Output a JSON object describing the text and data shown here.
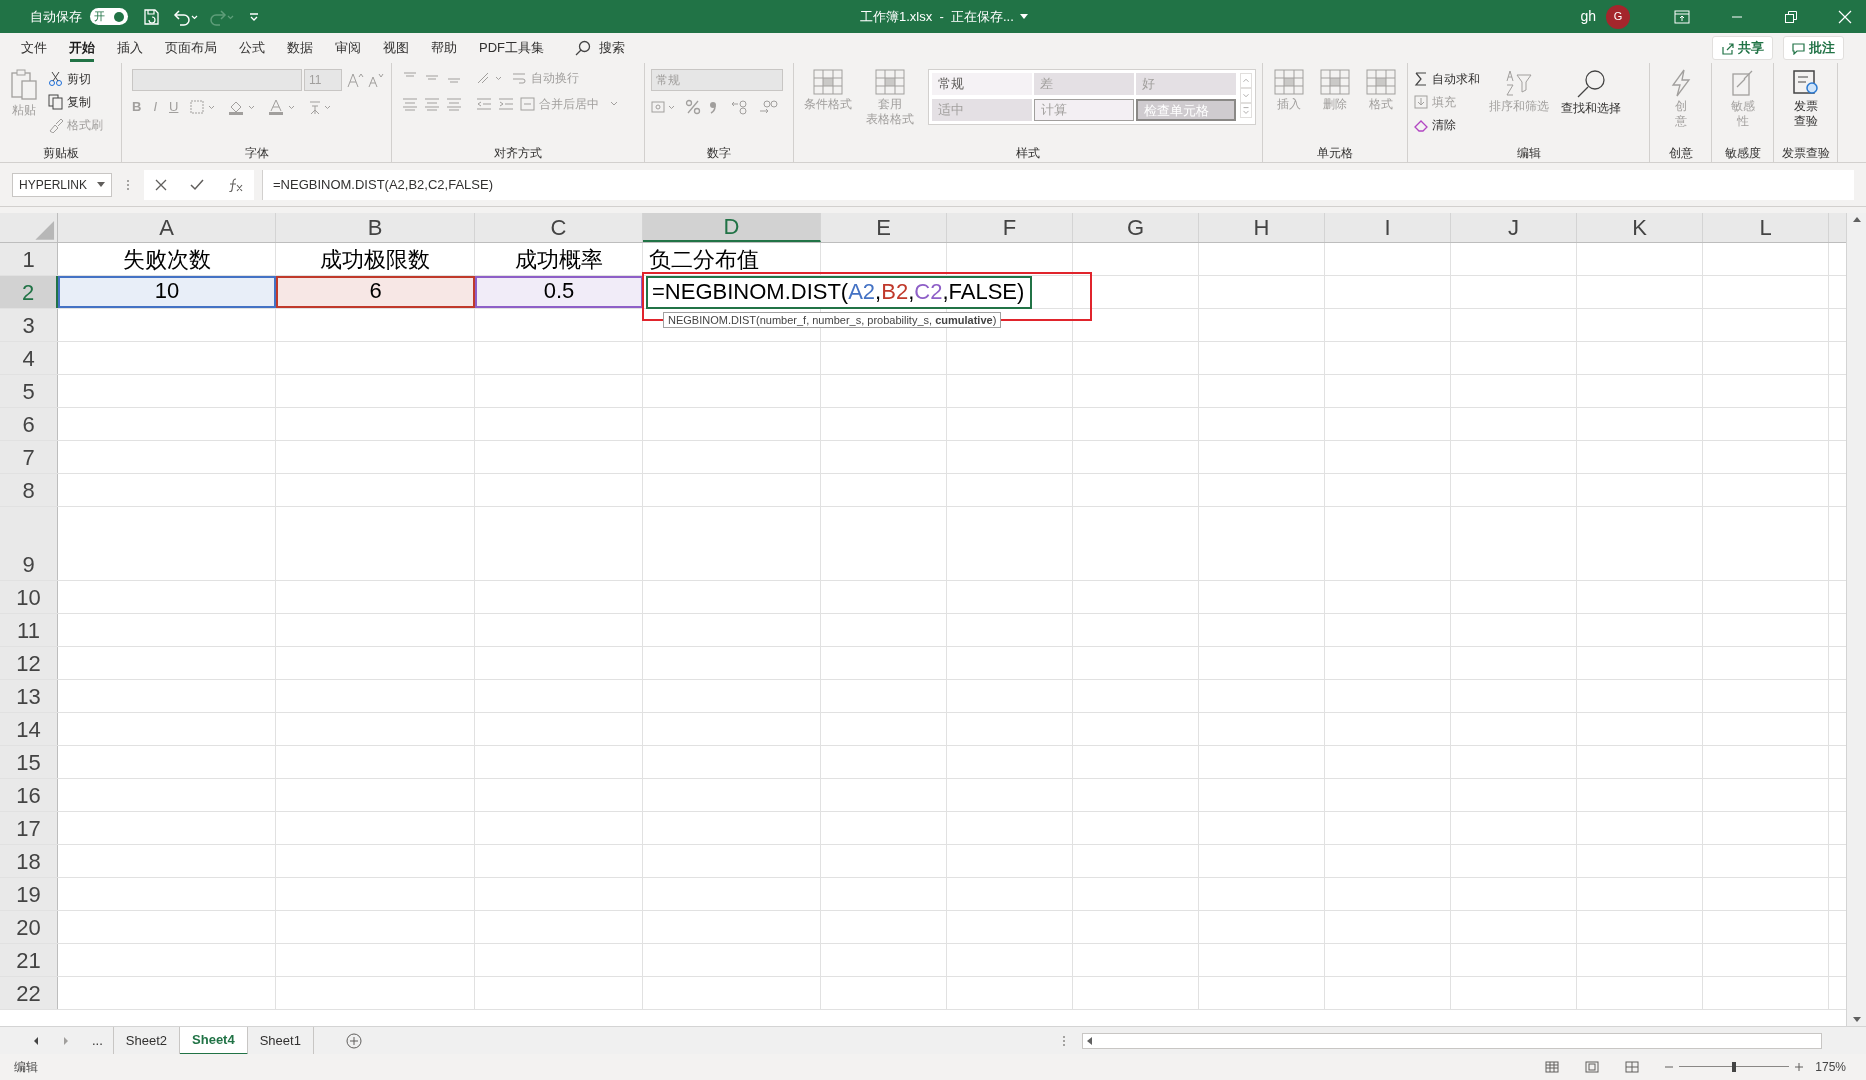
{
  "title_bar": {
    "autosave_label": "自动保存",
    "autosave_toggle": {
      "label": "开",
      "on": true
    },
    "title": "工作簿1.xlsx  -  正在保存...",
    "user": "gh",
    "avatar": "G"
  },
  "menu_tabs": [
    {
      "label": "文件",
      "selected": false
    },
    {
      "label": "开始",
      "selected": true
    },
    {
      "label": "插入",
      "selected": false
    },
    {
      "label": "页面布局",
      "selected": false
    },
    {
      "label": "公式",
      "selected": false
    },
    {
      "label": "数据",
      "selected": false
    },
    {
      "label": "审阅",
      "selected": false
    },
    {
      "label": "视图",
      "selected": false
    },
    {
      "label": "帮助",
      "selected": false
    },
    {
      "label": "PDF工具集",
      "selected": false
    }
  ],
  "search": {
    "label": "搜索"
  },
  "share_button": "共享",
  "comments_button": "批注",
  "ribbon": {
    "groups": [
      {
        "kind": "clipboard",
        "label": "剪贴板",
        "paste": {
          "label": "粘贴",
          "disabled": true
        },
        "tools": [
          {
            "label": "剪切",
            "disabled": false
          },
          {
            "label": "复制",
            "disabled": false
          },
          {
            "label": "格式刷",
            "disabled": true
          }
        ]
      },
      {
        "kind": "font",
        "label": "字体",
        "size": "11",
        "styles": [
          "B",
          "I",
          "U"
        ],
        "disabled": true
      },
      {
        "kind": "align",
        "label": "对齐方式",
        "tools": [
          {
            "label": "自动换行"
          },
          {
            "label": "合并后居中"
          }
        ],
        "disabled": true
      },
      {
        "kind": "number",
        "label": "数字",
        "format": "常规",
        "disabled": true
      },
      {
        "kind": "styles",
        "label": "样式",
        "buttons": [
          {
            "lines": [
              "条件格式"
            ],
            "disabled": true
          },
          {
            "lines": [
              "套用",
              "表格格式"
            ],
            "disabled": true
          }
        ],
        "cells": [
          {
            "label": "常规",
            "kind": "normal"
          },
          {
            "label": "差",
            "kind": "bad"
          },
          {
            "label": "好",
            "kind": "good"
          },
          {
            "label": "适中",
            "kind": "neutral"
          },
          {
            "label": "计算",
            "kind": "calc"
          },
          {
            "label": "检查单元格",
            "kind": "check"
          }
        ],
        "disabled": true
      },
      {
        "kind": "big",
        "label": "单元格",
        "buttons": [
          {
            "lines": [
              "插入"
            ],
            "disabled": true
          },
          {
            "lines": [
              "删除"
            ],
            "disabled": true
          },
          {
            "lines": [
              "格式"
            ],
            "disabled": true
          }
        ]
      },
      {
        "kind": "editing",
        "label": "编辑",
        "tools": [
          {
            "label": "自动求和",
            "disabled": false
          },
          {
            "label": "填充",
            "disabled": true
          },
          {
            "label": "清除",
            "disabled": false
          }
        ],
        "buttons": [
          {
            "lines": [
              "排序和筛选"
            ],
            "disabled": true
          },
          {
            "lines": [
              "查找和选择"
            ],
            "disabled": false
          }
        ]
      },
      {
        "kind": "big",
        "label": "创意",
        "buttons": [
          {
            "lines": [
              "创",
              "意"
            ],
            "disabled": true
          }
        ]
      },
      {
        "kind": "big",
        "label": "敏感度",
        "buttons": [
          {
            "lines": [
              "敏感",
              "性"
            ],
            "disabled": true
          }
        ]
      },
      {
        "kind": "big",
        "label": "发票查验",
        "buttons": [
          {
            "lines": [
              "发票",
              "查验"
            ],
            "disabled": false
          }
        ]
      }
    ]
  },
  "name_box": "HYPERLINK",
  "formula": "=NEGBINOM.DIST(A2,B2,C2,FALSE)",
  "columns": [
    {
      "label": "A",
      "selected": false
    },
    {
      "label": "B",
      "selected": false
    },
    {
      "label": "C",
      "selected": false
    },
    {
      "label": "D",
      "selected": true
    },
    {
      "label": "E",
      "selected": false
    },
    {
      "label": "F",
      "selected": false
    },
    {
      "label": "G",
      "selected": false
    },
    {
      "label": "H",
      "selected": false
    },
    {
      "label": "I",
      "selected": false
    },
    {
      "label": "J",
      "selected": false
    },
    {
      "label": "K",
      "selected": false
    },
    {
      "label": "L",
      "selected": false
    }
  ],
  "rows": [
    {
      "label": "1",
      "selected": false,
      "cells": [
        {
          "text": "失败次数"
        },
        {
          "text": "成功极限数"
        },
        {
          "text": "成功概率"
        },
        {
          "text": "负二分布值"
        }
      ]
    },
    {
      "label": "2",
      "selected": true,
      "cells": [
        {
          "text": "10",
          "color": "#4472c4"
        },
        {
          "text": "6",
          "color": "#c0392b"
        },
        {
          "text": "0.5",
          "color": "#8e5fc7"
        }
      ]
    },
    {
      "label": "3",
      "selected": false
    },
    {
      "label": "4",
      "selected": false
    },
    {
      "label": "5",
      "selected": false
    },
    {
      "label": "6",
      "selected": false
    },
    {
      "label": "7",
      "selected": false
    },
    {
      "label": "8",
      "selected": false
    },
    {
      "label": "9",
      "selected": false
    },
    {
      "label": "10",
      "selected": false
    },
    {
      "label": "11",
      "selected": false
    },
    {
      "label": "12",
      "selected": false
    },
    {
      "label": "13",
      "selected": false
    },
    {
      "label": "14",
      "selected": false
    },
    {
      "label": "15",
      "selected": false
    },
    {
      "label": "16",
      "selected": false
    },
    {
      "label": "17",
      "selected": false
    },
    {
      "label": "18",
      "selected": false
    },
    {
      "label": "19",
      "selected": false
    },
    {
      "label": "20",
      "selected": false
    },
    {
      "label": "21",
      "selected": false
    },
    {
      "label": "22",
      "selected": false
    }
  ],
  "editing_cell": {
    "segments": [
      {
        "text": "=NEGBINOM.DIST(",
        "color": "#000000"
      },
      {
        "text": "A2",
        "color": "#4472c4"
      },
      {
        "text": ",",
        "color": "#000000"
      },
      {
        "text": "B2",
        "color": "#c0392b"
      },
      {
        "text": ",",
        "color": "#000000"
      },
      {
        "text": "C2",
        "color": "#8e5fc7"
      },
      {
        "text": ",FALSE)",
        "color": "#000000"
      }
    ]
  },
  "tooltip": "NEGBINOM.DIST(number_f, number_s, probability_s, **cumulative**)",
  "sheet_nav": "...",
  "sheet_tabs": [
    {
      "label": "Sheet2",
      "selected": false
    },
    {
      "label": "Sheet4",
      "selected": true
    },
    {
      "label": "Sheet1",
      "selected": false
    }
  ],
  "status": {
    "mode": "编辑",
    "zoom": {
      "level": 0.5,
      "reading": "175%"
    }
  }
}
